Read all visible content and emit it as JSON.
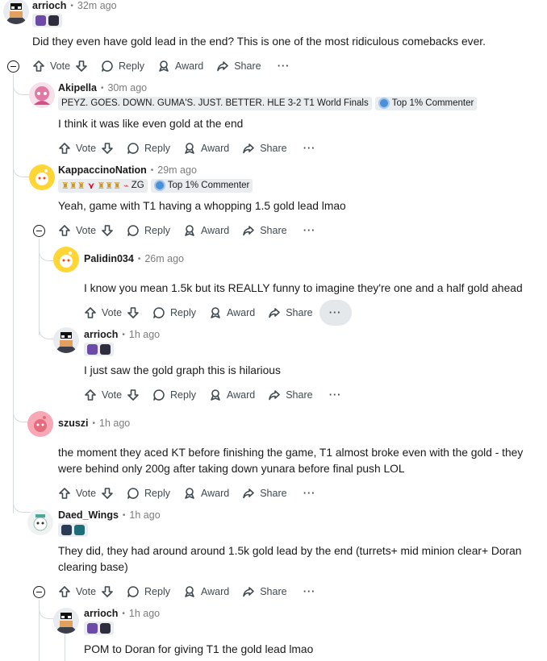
{
  "actions": {
    "vote": "Vote",
    "reply": "Reply",
    "award": "Award",
    "share": "Share",
    "more": "···"
  },
  "comments": [
    {
      "username": "arrioch",
      "time": "32m ago",
      "text": "Did they even have gold lead in the end? This is one of the most ridiculous comebacks ever."
    },
    {
      "username": "Akipella",
      "time": "30m ago",
      "flair": "PEYZ. GOES. DOWN. GUMA'S. JUST. BETTER. HLE 3-2 T1 World Finals",
      "badge": "Top 1% Commenter",
      "text": "I think it was like even gold at the end"
    },
    {
      "username": "KappaccinoNation",
      "time": "29m ago",
      "flair": "ZG",
      "badge": "Top 1% Commenter",
      "text": "Yeah, game with T1 having a whopping 1.5 gold lead lmao"
    },
    {
      "username": "Palidin034",
      "time": "26m ago",
      "text": "I know you mean 1.5k but its REALLY funny to imagine they're one and a half gold ahead"
    },
    {
      "username": "arrioch",
      "time": "1h ago",
      "text": "I just saw the gold graph this is hilarious"
    },
    {
      "username": "szuszi",
      "time": "1h ago",
      "text_line1": "the moment they aced KT before finishing the game, T1 almost broke even with the gold - they",
      "text_line2": "were behind only 200g after taking down yunara before final push LOL"
    },
    {
      "username": "Daed_Wings",
      "time": "1h ago",
      "text_line1": "They did, they had around around 1.5k gold lead by the end (turrets+ mid minion clear+ Doran",
      "text_line2": "clearing base)"
    },
    {
      "username": "arrioch",
      "time": "1h ago",
      "text": "POM to Doran for giving T1 the gold lead lmao"
    }
  ],
  "colors": {
    "thread": "#d6dadd",
    "meta": "#7c7c7c",
    "action": "#3f4a50",
    "flair_bg": "#eaedef"
  }
}
